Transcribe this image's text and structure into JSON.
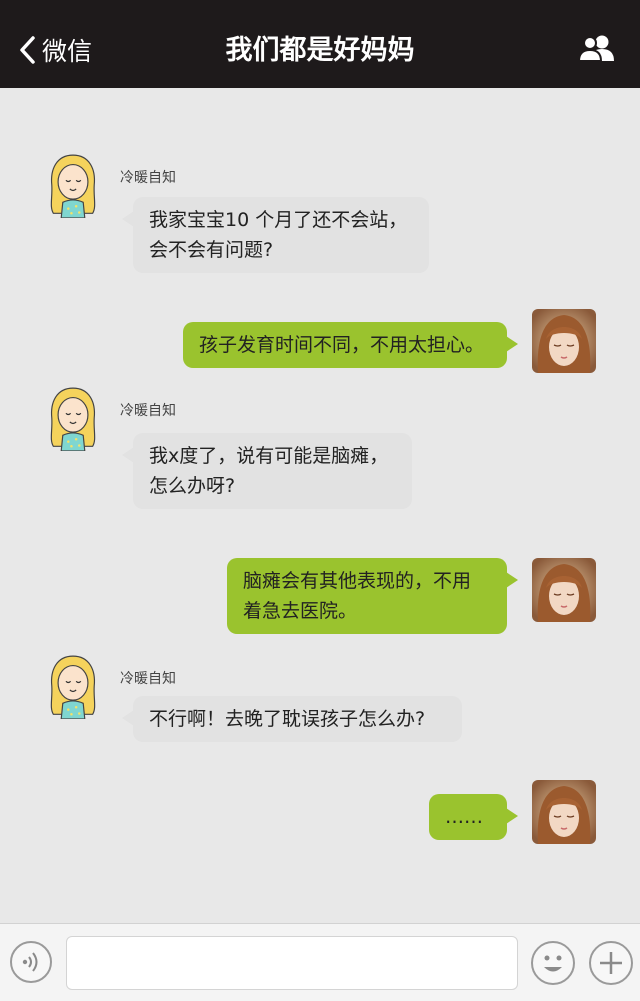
{
  "header": {
    "back_label": "微信",
    "title": "我们都是好妈妈"
  },
  "messages": [
    {
      "side": "left",
      "sender": "冷暖自知",
      "lines": [
        "我家宝宝10 个月了还不会站，",
        "会不会有问题?"
      ]
    },
    {
      "side": "right",
      "lines": [
        "孩子发育时间不同，不用太担心。"
      ]
    },
    {
      "side": "left",
      "sender": "冷暖自知",
      "lines": [
        "我x度了，说有可能是脑瘫，",
        "怎么办呀?"
      ]
    },
    {
      "side": "right",
      "lines": [
        "脑瘫会有其他表现的，不用",
        "着急去医院。"
      ]
    },
    {
      "side": "left",
      "sender": "冷暖自知",
      "lines": [
        "不行啊！去晚了耽误孩子怎么办?"
      ]
    },
    {
      "side": "right",
      "lines": [
        "……"
      ]
    }
  ],
  "input": {
    "placeholder": ""
  },
  "colors": {
    "header_bg": "#1e1a1b",
    "background": "#e8e8e8",
    "received_bubble": "#e2e2e2",
    "sent_bubble": "#9ac32e"
  },
  "icons": {
    "back": "chevron-left-icon",
    "members": "people-icon",
    "voice": "voice-icon",
    "emoji": "smiley-icon",
    "plus": "plus-icon"
  }
}
